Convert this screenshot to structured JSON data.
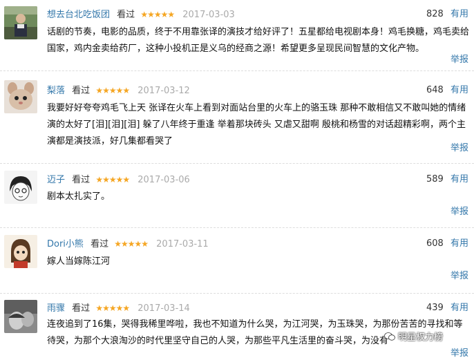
{
  "reviews": [
    {
      "username": "想去台北吃饭团",
      "status": "看过",
      "rating_stars": "★★★★★",
      "rating": 5,
      "date": "2017-03-03",
      "votes": "828",
      "useful_label": "有用",
      "text": "话剧的节奏，电影的品质，终于不用靠张译的演技才给好评了！五星都给电视剧本身！鸡毛换糖，鸡毛卖给国家，鸡内金卖给药厂，这种小投机正是义乌的经商之源！希望更多呈现民间智慧的文化产物。",
      "report_label": "举报"
    },
    {
      "username": "梨落",
      "status": "看过",
      "rating_stars": "★★★★★",
      "rating": 5,
      "date": "2017-03-12",
      "votes": "648",
      "useful_label": "有用",
      "text": "我要好好夸夸鸡毛飞上天 张译在火车上看到对面站台里的火车上的骆玉珠 那种不敢相信又不敢叫她的情绪演的太好了[泪][泪][泪] 躲了八年终于重逢 举着那块砖头 又虐又甜啊 殷桃和杨雪的对话超精彩啊，两个主演都是演技派，好几集都看哭了",
      "report_label": "举报"
    },
    {
      "username": "迈子",
      "status": "看过",
      "rating_stars": "★★★★★",
      "rating": 5,
      "date": "2017-03-06",
      "votes": "589",
      "useful_label": "有用",
      "text": "剧本太扎实了。",
      "report_label": "举报"
    },
    {
      "username": "Dori小熊",
      "status": "看过",
      "rating_stars": "★★★★★",
      "rating": 5,
      "date": "2017-03-11",
      "votes": "608",
      "useful_label": "有用",
      "text": "嫁人当嫁陈江河",
      "report_label": "举报"
    },
    {
      "username": "雨骤",
      "status": "看过",
      "rating_stars": "★★★★★",
      "rating": 5,
      "date": "2017-03-14",
      "votes": "439",
      "useful_label": "有用",
      "text": "连夜追到了16集，哭得我稀里哗啦，我也不知道为什么哭，为江河哭，为玉珠哭，为那份苦苦的寻找和等待哭，为那个大浪淘沙的时代里坚守自己的人哭，为那些平凡生活里的奋斗哭，为没有",
      "report_label": "举报"
    }
  ],
  "watermark": "明星权力榜",
  "colors": {
    "link": "#3377aa",
    "star": "#f5a623",
    "date": "#aaaaaa",
    "divider": "#dddddd"
  }
}
